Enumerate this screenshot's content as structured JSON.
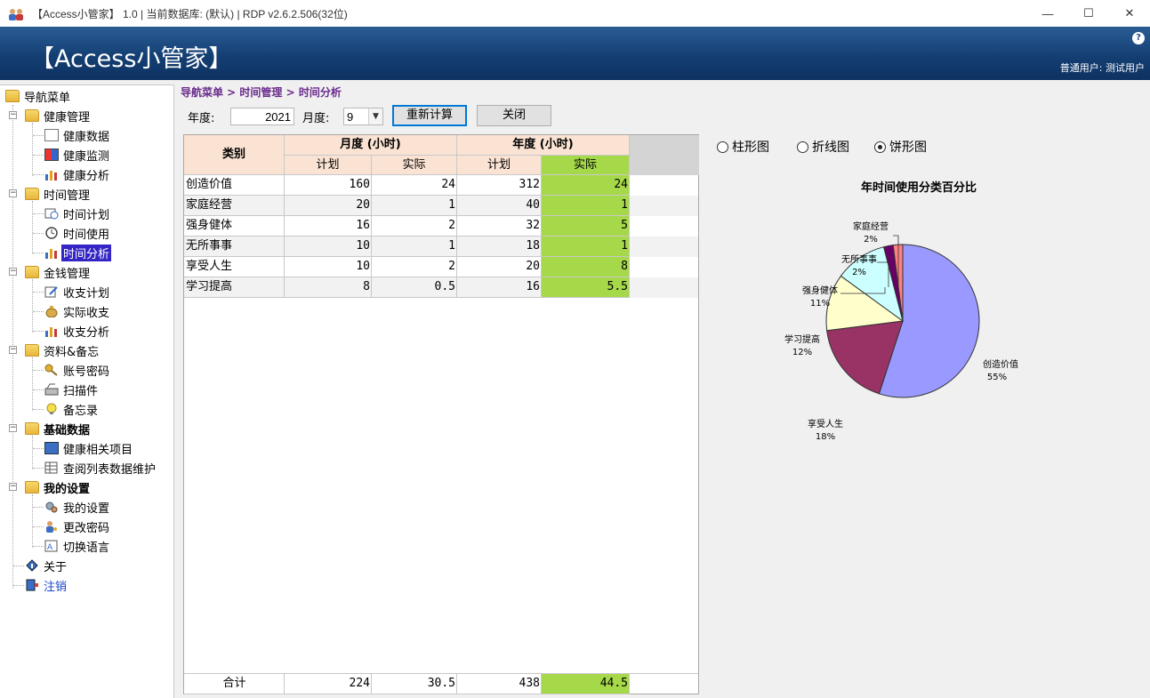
{
  "titlebar": {
    "text": "【Access小管家】 1.0 | 当前数据库: (默认) | RDP v2.6.2.506(32位)",
    "minimize_glyph": "—",
    "maximize_glyph": "☐",
    "close_glyph": "✕"
  },
  "banner": {
    "brand": "【Access小管家】",
    "help_glyph": "?",
    "user_label": "普通用户: 测试用户"
  },
  "sidebar": {
    "root": "导航菜单",
    "groups": [
      {
        "label": "健康管理",
        "items": [
          "健康数据",
          "健康监测",
          "健康分析"
        ]
      },
      {
        "label": "时间管理",
        "items": [
          "时间计划",
          "时间使用",
          "时间分析"
        ]
      },
      {
        "label": "金钱管理",
        "items": [
          "收支计划",
          "实际收支",
          "收支分析"
        ]
      },
      {
        "label": "资料&备忘",
        "items": [
          "账号密码",
          "扫描件",
          "备忘录"
        ]
      },
      {
        "label": "基础数据",
        "items": [
          "健康相关项目",
          "查阅列表数据维护"
        ]
      },
      {
        "label": "我的设置",
        "items": [
          "我的设置",
          "更改密码",
          "切换语言"
        ]
      }
    ],
    "about": "关于",
    "logout": "注销"
  },
  "breadcrumb": "导航菜单 > 时间管理 > 时间分析",
  "toolbar": {
    "year_label": "年度:",
    "year_value": "2021",
    "month_label": "月度:",
    "month_value": "9",
    "recalc_label": "重新计算",
    "close_label": "关闭"
  },
  "grid": {
    "header_category": "类别",
    "header_month": "月度 (小时)",
    "header_year": "年度 (小时)",
    "sub_plan": "计划",
    "sub_actual": "实际",
    "rows": [
      {
        "cat": "创造价值",
        "m_plan": "160",
        "m_actual": "24",
        "y_plan": "312",
        "y_actual": "24"
      },
      {
        "cat": "家庭经营",
        "m_plan": "20",
        "m_actual": "1",
        "y_plan": "40",
        "y_actual": "1"
      },
      {
        "cat": "强身健体",
        "m_plan": "16",
        "m_actual": "2",
        "y_plan": "32",
        "y_actual": "5"
      },
      {
        "cat": "无所事事",
        "m_plan": "10",
        "m_actual": "1",
        "y_plan": "18",
        "y_actual": "1"
      },
      {
        "cat": "享受人生",
        "m_plan": "10",
        "m_actual": "2",
        "y_plan": "20",
        "y_actual": "8"
      },
      {
        "cat": "学习提高",
        "m_plan": "8",
        "m_actual": "0.5",
        "y_plan": "16",
        "y_actual": "5.5"
      }
    ],
    "total": {
      "cat": "合计",
      "m_plan": "224",
      "m_actual": "30.5",
      "y_plan": "438",
      "y_actual": "44.5"
    },
    "highlight_color": "#a6d949",
    "header_color": "#fbe3d3"
  },
  "chart_options": {
    "bar_label": "柱形图",
    "line_label": "折线图",
    "pie_label": "饼形图",
    "selected": "pie"
  },
  "chart_data": {
    "type": "pie",
    "title": "年时间使用分类百分比",
    "slices": [
      {
        "label": "创造价值",
        "pct": "55%",
        "value": 55,
        "color": "#9999ff"
      },
      {
        "label": "享受人生",
        "pct": "18%",
        "value": 18,
        "color": "#993366"
      },
      {
        "label": "学习提高",
        "pct": "12%",
        "value": 12,
        "color": "#ffffcc"
      },
      {
        "label": "强身健体",
        "pct": "11%",
        "value": 11,
        "color": "#ccffff"
      },
      {
        "label": "无所事事",
        "pct": "2%",
        "value": 2,
        "color": "#660066"
      },
      {
        "label": "家庭经营",
        "pct": "2%",
        "value": 2,
        "color": "#ff8080"
      }
    ]
  }
}
